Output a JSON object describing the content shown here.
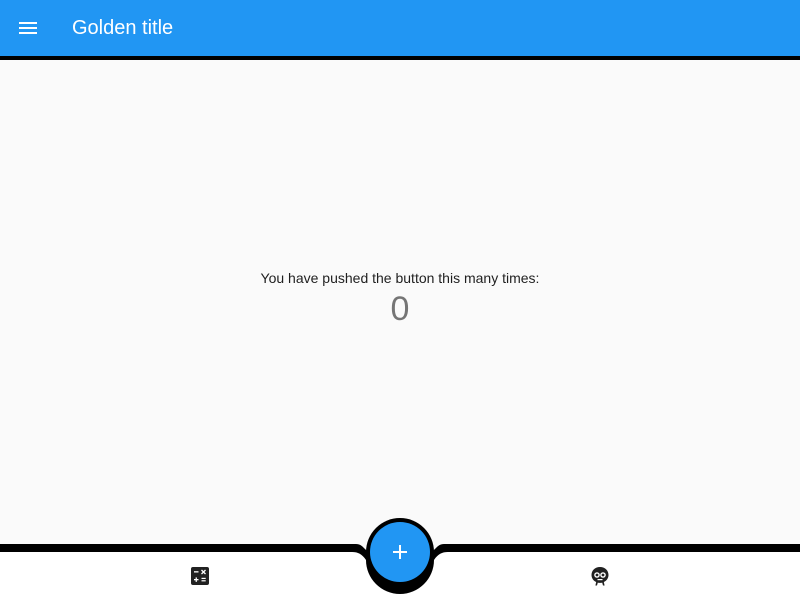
{
  "appbar": {
    "title": "Golden title",
    "menu_icon": "menu-icon",
    "color": "#2196f3"
  },
  "main": {
    "message": "You have pushed the button this many times:",
    "counter": "0"
  },
  "fab": {
    "icon": "add-icon",
    "color": "#2196f3"
  },
  "bottom_nav": {
    "items": [
      {
        "icon": "calculator-icon"
      },
      {
        "icon": "robot-icon"
      }
    ]
  }
}
